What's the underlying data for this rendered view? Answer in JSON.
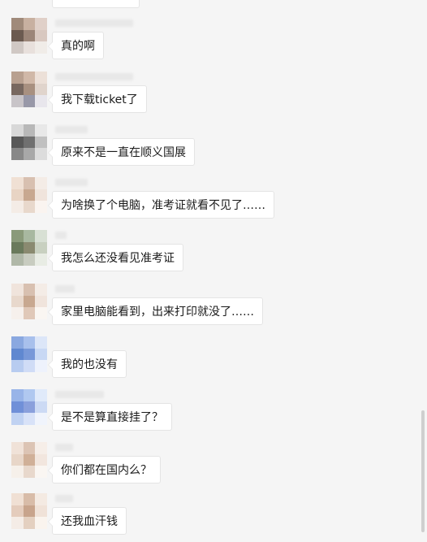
{
  "messages": [
    {
      "text": "真的啊",
      "avatar": [
        "#a08a7a",
        "#c8b0a0",
        "#e0d0c8",
        "#6b5a50",
        "#9b8578",
        "#d8c8c0",
        "#d0c8c4",
        "#e8e0dc",
        "#f0ece8"
      ]
    },
    {
      "text": "我下载ticket了",
      "avatar": [
        "#b8a090",
        "#d0b8a8",
        "#ece0d8",
        "#786860",
        "#a89080",
        "#e0d4cc",
        "#c8c4c8",
        "#9898a8",
        "#e8e6ec"
      ]
    },
    {
      "text": "原来不是一直在顺义国展",
      "avatar": [
        "#d8d8d8",
        "#b8b8b8",
        "#e8e8e8",
        "#585858",
        "#707070",
        "#c0c0c0",
        "#888888",
        "#a8a8a8",
        "#dcdcdc"
      ]
    },
    {
      "text": "为啥换了个电脑，准考证就看不见了……",
      "avatar": [
        "#f0e0d4",
        "#d8c0b0",
        "#f4ece6",
        "#e8d4c4",
        "#c8a890",
        "#f0e4dc",
        "#f4ece6",
        "#e8d8cc",
        "#faf4f0"
      ]
    },
    {
      "text": "我怎么还没看见准考证",
      "avatar": [
        "#8a9a7a",
        "#a8b8a0",
        "#d8e0d4",
        "#6a7a5c",
        "#8a8a70",
        "#c8d0c0",
        "#b0b8a8",
        "#c8ccc0",
        "#e8ece4"
      ]
    },
    {
      "text": "家里电脑能看到，出来打印就没了……",
      "avatar": [
        "#f0e4dc",
        "#d8c0b0",
        "#f4ece6",
        "#e8d8cc",
        "#c8a890",
        "#f0e4dc",
        "#f6f0ec",
        "#e0c8b8",
        "#faf6f2"
      ]
    },
    {
      "text": "我的也没有",
      "avatar": [
        "#8aa8e0",
        "#a8c0ec",
        "#dce6f8",
        "#6088d0",
        "#7898d8",
        "#c8d8f4",
        "#b8ccf0",
        "#d0dcf6",
        "#eef2fc"
      ]
    },
    {
      "text": "是不是算直接挂了？",
      "avatar": [
        "#98b4e8",
        "#b0c8f0",
        "#e0eafa",
        "#7090d8",
        "#8aa0dc",
        "#ccdaf4",
        "#c0d2f2",
        "#d8e2f8",
        "#f0f4fc"
      ]
    },
    {
      "text": "你们都在国内么？",
      "avatar": [
        "#f0e2d8",
        "#dcc4b4",
        "#f6eee8",
        "#e8d6c8",
        "#d0b098",
        "#f2e6de",
        "#f6f0ea",
        "#e8d8cc",
        "#faf6f2"
      ]
    },
    {
      "text": "还我血汗钱",
      "avatar": [
        "#f0e0d4",
        "#d8bca8",
        "#f4eae2",
        "#e4ccbc",
        "#c8a48c",
        "#f0e2d8",
        "#f4ece6",
        "#e4d0c0",
        "#faf4ee"
      ]
    }
  ]
}
